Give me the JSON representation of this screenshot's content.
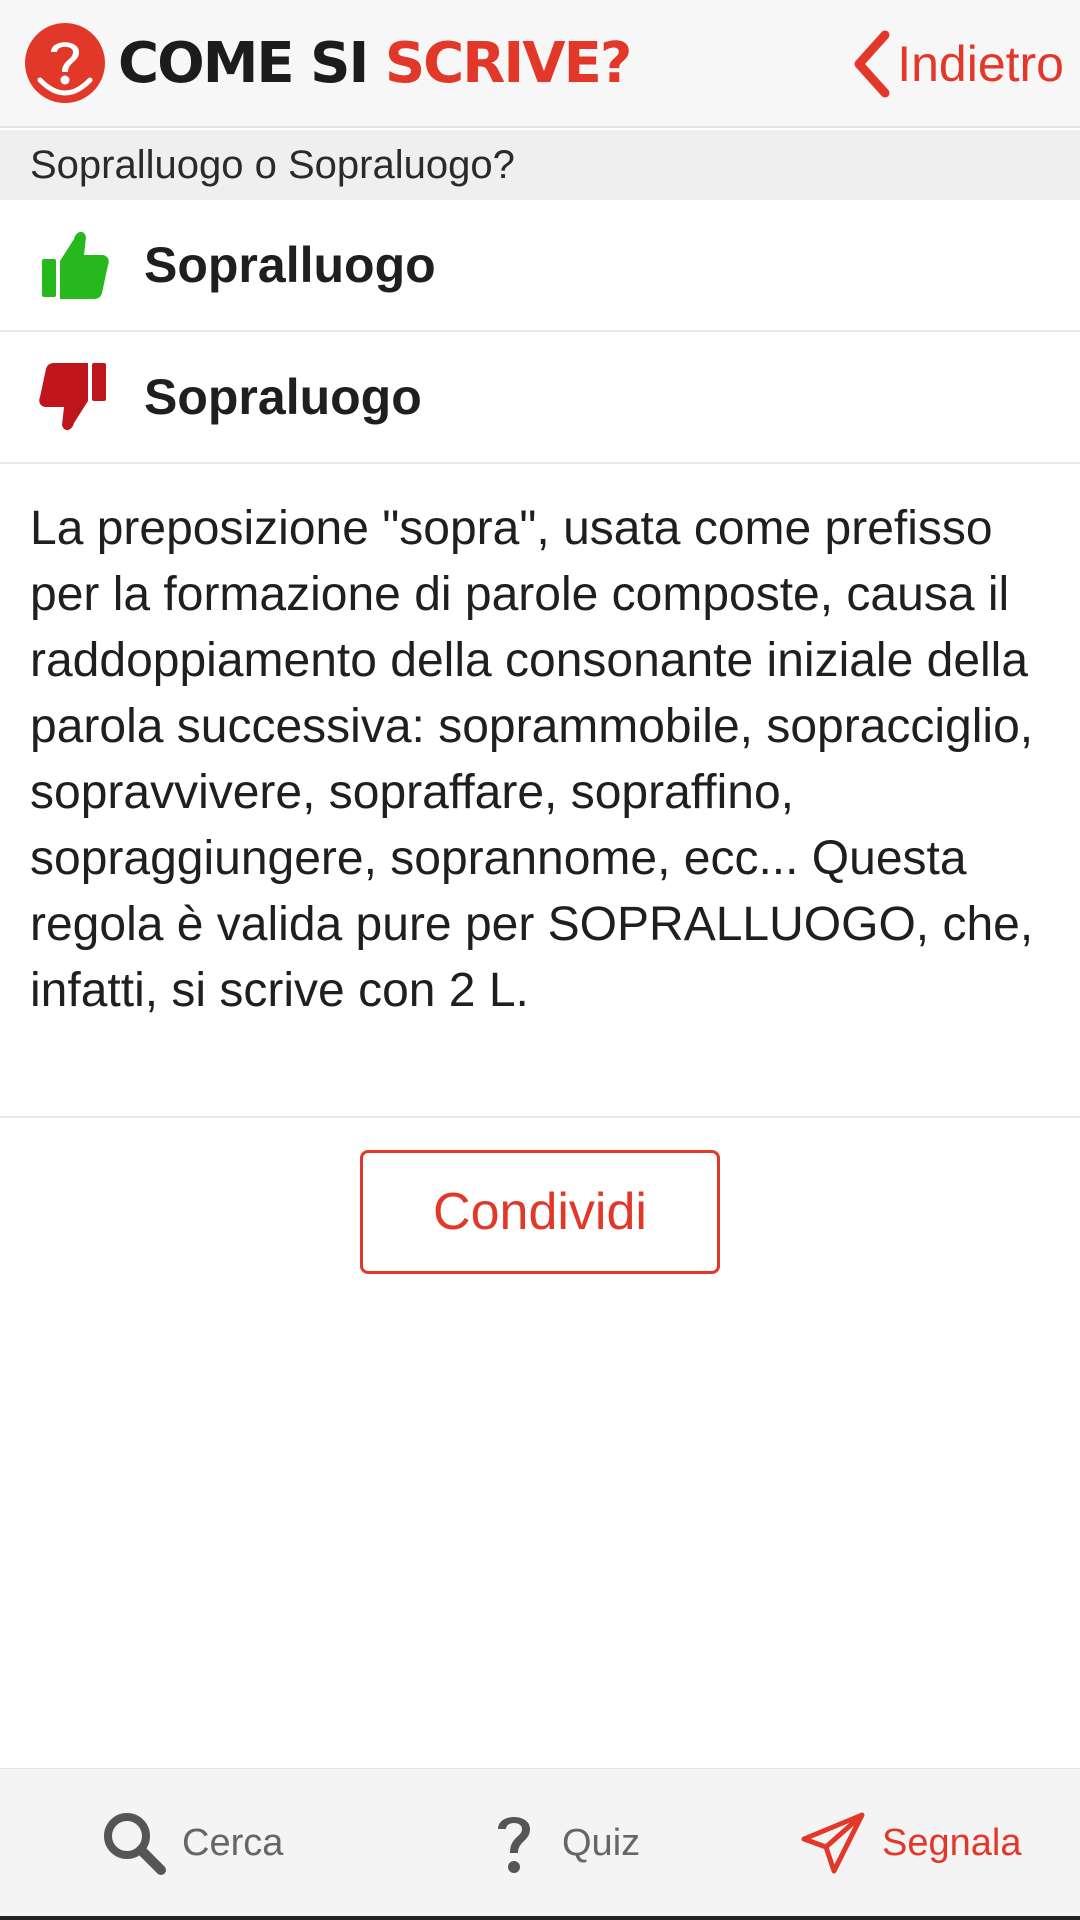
{
  "header": {
    "logo_dark": "COME SI ",
    "logo_red": "SCRIVE?",
    "back_label": "Indietro"
  },
  "question": "Sopralluogo o Sopraluogo?",
  "options": {
    "correct": "Sopralluogo",
    "wrong": "Sopraluogo"
  },
  "explanation": "La preposizione \"sopra\", usata come prefisso per la formazione di parole composte, causa il raddoppiamento della consonante iniziale della parola successiva: soprammobile, sopracciglio, sopravvivere, sopraffare, sopraffino, sopraggiungere, soprannome, ecc... Questa regola è valida pure per SOPRALLUOGO, che, infatti, si scrive con 2 L.",
  "share_label": "Condividi",
  "nav": {
    "search_label": "Cerca",
    "quiz_label": "Quiz",
    "report_label": "Segnala"
  },
  "colors": {
    "accent": "#e2382a",
    "correct": "#27b81e",
    "wrong": "#c0151a",
    "nav_inactive": "#666666"
  },
  "icons": {
    "logo": "question-circle-icon",
    "back": "chevron-left-icon",
    "correct": "thumbs-up-icon",
    "wrong": "thumbs-down-icon",
    "search": "search-icon",
    "quiz": "question-mark-icon",
    "report": "paper-plane-icon"
  }
}
